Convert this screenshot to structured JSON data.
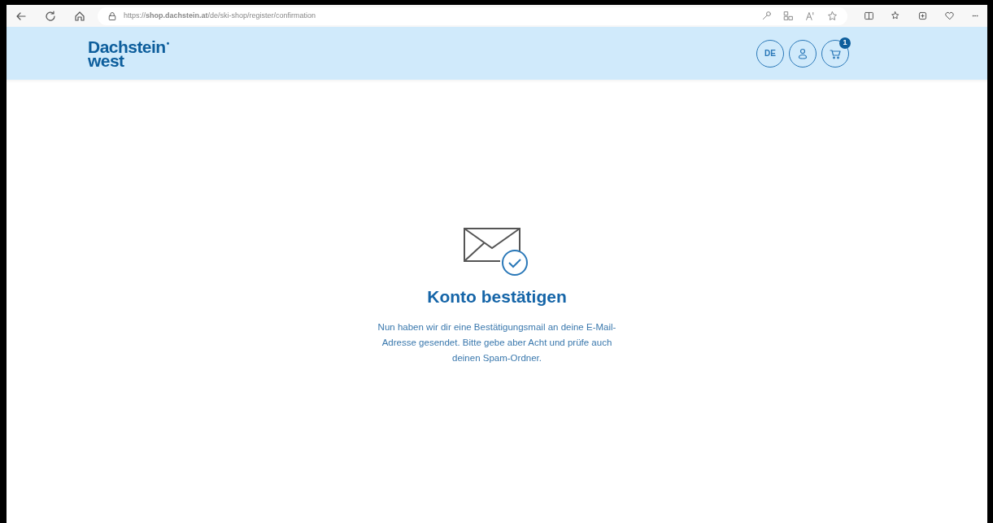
{
  "browser": {
    "url": "https://**shop.dachstein.at**/de/ski-shop/register/confirmation"
  },
  "header": {
    "logo_line_1": "Dachstein",
    "logo_mark": "•",
    "logo_line_2": "west",
    "language": "DE",
    "cart_count": "1"
  },
  "confirmation": {
    "title": "Konto bestätigen",
    "message": "Nun haben wir dir eine Bestätigungsmail an deine E-Mail-Adresse gesendet. Bitte gebe aber Acht und prüfe auch deinen Spam-Ordner."
  }
}
